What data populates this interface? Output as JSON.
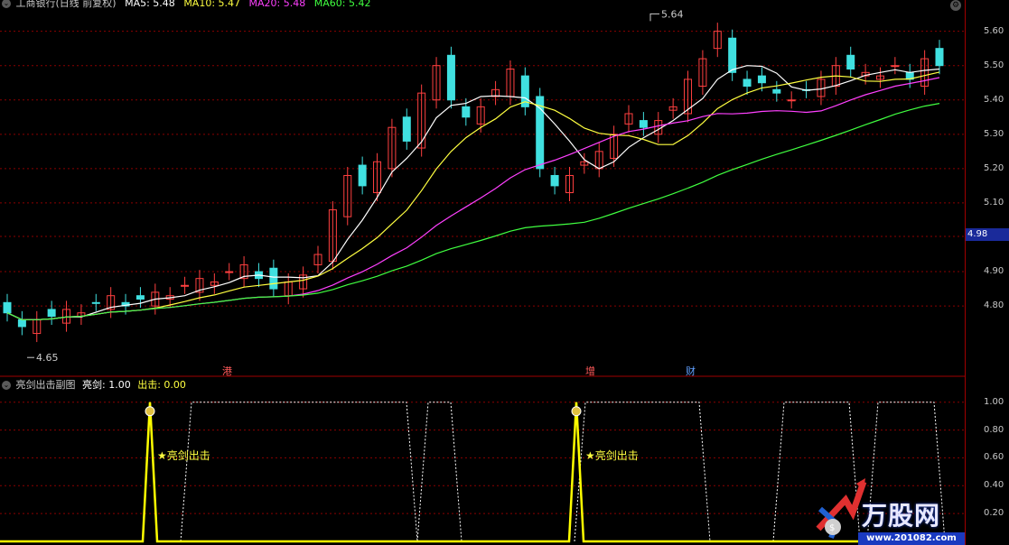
{
  "main": {
    "title": "工商银行(日线 前复权)",
    "ma": [
      {
        "label": "MA5: 5.48",
        "color": "#ffffff"
      },
      {
        "label": "MA10: 5.47",
        "color": "#ffff40"
      },
      {
        "label": "MA20: 5.48",
        "color": "#ff40ff"
      },
      {
        "label": "MA60: 5.42",
        "color": "#40ff40"
      }
    ],
    "high_label": "5.64",
    "low_label": "4.65",
    "current_price": "4.98",
    "price_ticks": [
      "5.60",
      "5.50",
      "5.40",
      "5.30",
      "5.20",
      "5.10",
      "4.90",
      "4.80"
    ],
    "event_tags": [
      {
        "label": "港",
        "color": "#ff5a5a"
      },
      {
        "label": "增",
        "color": "#ff5a5a"
      },
      {
        "label": "财",
        "color": "#60a0ff"
      }
    ]
  },
  "sub": {
    "title": "亮剑出击副图",
    "values": [
      {
        "label": "亮剑: 1.00",
        "color": "#ffffff"
      },
      {
        "label": "出击: 0.00",
        "color": "#ffff40"
      }
    ],
    "signal_label": "★亮剑出击",
    "ticks": [
      "1.00",
      "0.80",
      "0.60",
      "0.40",
      "0.20"
    ]
  },
  "watermark": {
    "brand": "万股网",
    "url": "www.201082.com"
  },
  "colors": {
    "up": "#ff4040",
    "down": "#40e0e0",
    "grid": "#8b0000",
    "ma5": "#ffffff",
    "ma10": "#ffff40",
    "ma20": "#ff40ff",
    "ma60": "#40ff40",
    "signal": "#ffff00"
  },
  "chart_data": {
    "type": "candlestick",
    "title": "工商银行(日线 前复权)",
    "y_range": [
      4.64,
      5.67
    ],
    "high": 5.64,
    "low": 4.65,
    "ma_latest": {
      "MA5": 5.48,
      "MA10": 5.47,
      "MA20": 5.48,
      "MA60": 5.42
    },
    "close_path": [
      4.78,
      4.74,
      4.76,
      4.77,
      4.79,
      4.78,
      4.81,
      4.83,
      4.8,
      4.82,
      4.84,
      4.83,
      4.86,
      4.88,
      4.87,
      4.9,
      4.92,
      4.88,
      4.85,
      4.87,
      4.89,
      4.95,
      5.08,
      5.18,
      5.15,
      5.22,
      5.32,
      5.28,
      5.42,
      5.5,
      5.4,
      5.35,
      5.38,
      5.43,
      5.49,
      5.38,
      5.2,
      5.15,
      5.18,
      5.22,
      5.25,
      5.3,
      5.36,
      5.32,
      5.34,
      5.38,
      5.46,
      5.52,
      5.6,
      5.48,
      5.44,
      5.45,
      5.42,
      5.4,
      5.43,
      5.46,
      5.5,
      5.49,
      5.48,
      5.47,
      5.5,
      5.46,
      5.52,
      5.5
    ],
    "sub_series": {
      "亮剑": 1.0,
      "出击": 0.0,
      "ylim": [
        0,
        1.05
      ]
    }
  }
}
